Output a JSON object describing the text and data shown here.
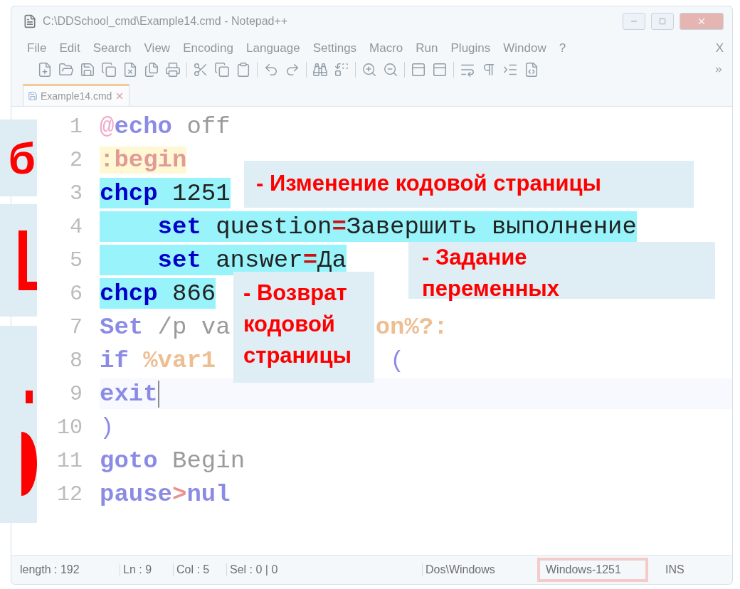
{
  "window": {
    "title": "C:\\DDSchool_cmd\\Example14.cmd - Notepad++"
  },
  "menu": [
    {
      "label": "File"
    },
    {
      "label": "Edit"
    },
    {
      "label": "Search"
    },
    {
      "label": "View"
    },
    {
      "label": "Encoding"
    },
    {
      "label": "Language"
    },
    {
      "label": "Settings"
    },
    {
      "label": "Macro"
    },
    {
      "label": "Run"
    },
    {
      "label": "Plugins"
    },
    {
      "label": "Window"
    },
    {
      "label": "?"
    }
  ],
  "menu_close": "X",
  "tabs": [
    {
      "label": "Example14.cmd",
      "selected": true
    }
  ],
  "code_lines": [
    {
      "number": "1",
      "highlighted": false,
      "current": false,
      "indented": false,
      "fragments": [
        [
          {
            "kind": "at",
            "text": "@"
          },
          {
            "kind": "keyword",
            "text": "echo"
          },
          {
            "kind": "plain",
            "text": " off"
          }
        ]
      ]
    },
    {
      "number": "2",
      "highlighted": false,
      "current": false,
      "indented": false,
      "fragments": [
        [
          {
            "kind": "label",
            "text": ":begin"
          }
        ]
      ]
    },
    {
      "number": "3",
      "highlighted": true,
      "current": false,
      "indented": false,
      "fragments": [
        [
          {
            "kind": "keyword",
            "text": "chcp"
          },
          {
            "kind": "plain",
            "text": " 1251"
          }
        ]
      ]
    },
    {
      "number": "4",
      "highlighted": true,
      "current": false,
      "indented": true,
      "fragments": [
        [
          {
            "kind": "keyword",
            "text": "set"
          },
          {
            "kind": "plain",
            "text": " question"
          },
          {
            "kind": "operator",
            "text": "="
          },
          {
            "kind": "plain",
            "text": "Завершить выполнение"
          }
        ]
      ]
    },
    {
      "number": "5",
      "highlighted": true,
      "current": false,
      "indented": true,
      "fragments": [
        [
          {
            "kind": "keyword",
            "text": "set"
          },
          {
            "kind": "plain",
            "text": " answer"
          },
          {
            "kind": "operator",
            "text": "="
          },
          {
            "kind": "plain",
            "text": "Да"
          }
        ]
      ]
    },
    {
      "number": "6",
      "highlighted": true,
      "current": false,
      "indented": false,
      "fragments": [
        [
          {
            "kind": "keyword",
            "text": "chcp"
          },
          {
            "kind": "plain",
            "text": " 866"
          }
        ]
      ]
    },
    {
      "number": "7",
      "highlighted": false,
      "current": false,
      "indented": false,
      "fragments": [
        [
          {
            "kind": "keyword",
            "text": "Set"
          },
          {
            "kind": "plain",
            "text": " /p va"
          }
        ],
        [
          {
            "kind": "variable",
            "text": "on%?:"
          }
        ]
      ]
    },
    {
      "number": "8",
      "highlighted": false,
      "current": false,
      "indented": false,
      "fragments": [
        [
          {
            "kind": "keyword",
            "text": "if"
          },
          {
            "kind": "variable",
            "text": " %var1"
          }
        ],
        [
          {
            "kind": "bracket",
            "text": "("
          }
        ]
      ]
    },
    {
      "number": "9",
      "highlighted": false,
      "current": true,
      "indented": false,
      "fragments": [
        [
          {
            "kind": "keyword",
            "text": "exit"
          }
        ]
      ]
    },
    {
      "number": "10",
      "highlighted": false,
      "current": false,
      "indented": false,
      "fragments": [
        [
          {
            "kind": "bracket",
            "text": ")"
          }
        ]
      ]
    },
    {
      "number": "11",
      "highlighted": false,
      "current": false,
      "indented": false,
      "fragments": [
        [
          {
            "kind": "keyword",
            "text": "goto"
          },
          {
            "kind": "plain",
            "text": " Begin"
          }
        ]
      ]
    },
    {
      "number": "12",
      "highlighted": false,
      "current": false,
      "indented": false,
      "fragments": [
        [
          {
            "kind": "keyword",
            "text": "pause"
          },
          {
            "kind": "operator",
            "text": ">"
          },
          {
            "kind": "keyword",
            "text": "nul"
          }
        ]
      ]
    }
  ],
  "callouts": [
    {
      "lines": [
        "- Изменение кодовой страницы"
      ]
    },
    {
      "lines": [
        "- Задание",
        "переменных"
      ]
    },
    {
      "lines": [
        "- Возврат",
        "кодовой",
        "страницы"
      ]
    }
  ],
  "side_glyph": "б",
  "status_bar": {
    "length": "length : 192",
    "ln": "Ln : 9",
    "col": "Col : 5",
    "sel": "Sel : 0 | 0",
    "eol": "Dos\\Windows",
    "encoding": "Windows-1251",
    "encoding_marked": true,
    "mode": "INS"
  }
}
